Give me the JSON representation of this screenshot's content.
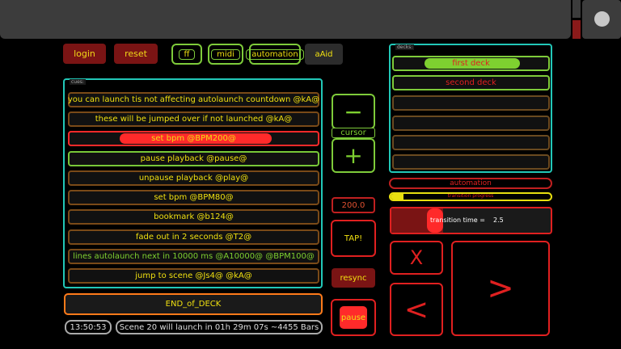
{
  "toolbar": {
    "login": "login",
    "reset": "reset",
    "ff": "ff",
    "midi": "midi",
    "automation": "automation",
    "aAid": "aAid"
  },
  "cues": {
    "label": "cues:",
    "items": [
      "you can launch tis not affecting autolaunch countdown @kA@",
      "these will be jumped over if not launched @kA@",
      "set bpm @BPM200@",
      "pause playback @pause@",
      "unpause playback @play@",
      "set bpm @BPM80@",
      "bookmark @b124@",
      "fade out in 2 seconds @T2@",
      "lines autolaunch next in 10000 ms @A10000@ @BPM100@",
      "jump to scene @Js4@ @kA@"
    ],
    "end": "END_of_DECK"
  },
  "cursor": {
    "minus": "−",
    "label": "cursor",
    "plus": "+"
  },
  "tempo": {
    "bpm": "200.0",
    "tap": "TAP!",
    "resync": "resync",
    "pause": "pause"
  },
  "status": {
    "clock": "13:50:53",
    "message": "Scene 20 will launch in 01h 29m 07s  ~4455 Bars"
  },
  "decks": {
    "label": "decks:",
    "items": [
      "first deck",
      "second deck",
      "",
      "",
      "",
      ""
    ]
  },
  "automation": {
    "label": "automation",
    "transition_progress_label": "transition progress",
    "transition_time_label": "transition time =",
    "transition_time_value": "2.5"
  },
  "nav": {
    "x": "X",
    "next": ">",
    "prev": "<"
  },
  "colors": {
    "accent_green": "#7ecb3a",
    "accent_red": "#e02020",
    "accent_teal": "#22c8b8",
    "text_yellow": "#f0e010"
  }
}
